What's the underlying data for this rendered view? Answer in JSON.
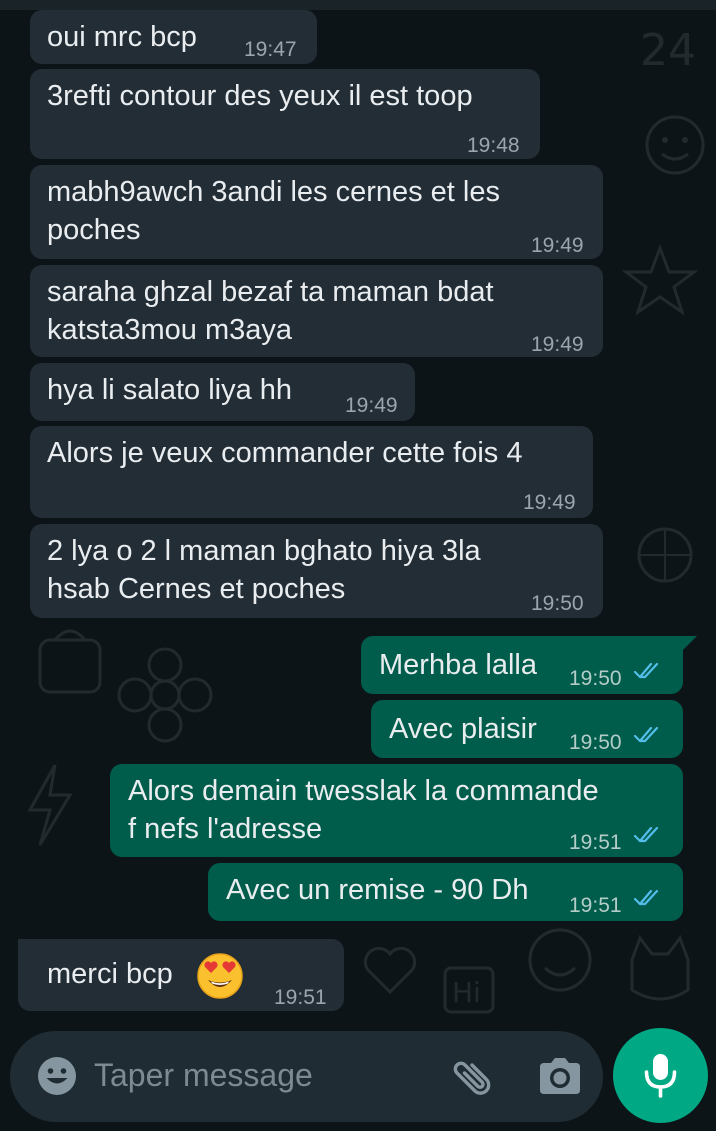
{
  "messages": [
    {
      "type": "incoming",
      "lines": [
        "oui mrc bcp"
      ],
      "time": "19:47"
    },
    {
      "type": "incoming",
      "lines": [
        "3refti contour des yeux il est toop"
      ],
      "time": "19:48"
    },
    {
      "type": "incoming",
      "lines": [
        "mabh9awch 3andi les cernes et les",
        "poches"
      ],
      "time": "19:49"
    },
    {
      "type": "incoming",
      "lines": [
        "saraha ghzal bezaf ta maman bdat",
        "katsta3mou m3aya"
      ],
      "time": "19:49"
    },
    {
      "type": "incoming",
      "lines": [
        "hya li salato liya hh"
      ],
      "time": "19:49"
    },
    {
      "type": "incoming",
      "lines": [
        "Alors je veux commander cette fois 4"
      ],
      "time": "19:49"
    },
    {
      "type": "incoming",
      "lines": [
        "2 lya o 2 l maman bghato hiya 3la",
        "hsab Cernes et poches"
      ],
      "time": "19:50"
    },
    {
      "type": "outgoing",
      "lines": [
        "Merhba lalla"
      ],
      "time": "19:50",
      "status": "read"
    },
    {
      "type": "outgoing",
      "lines": [
        "Avec plaisir"
      ],
      "time": "19:50",
      "status": "read"
    },
    {
      "type": "outgoing",
      "lines": [
        "Alors demain twesslak la commande",
        "f nefs l'adresse"
      ],
      "time": "19:51",
      "status": "read"
    },
    {
      "type": "outgoing",
      "lines": [
        "Avec un remise - 90 Dh"
      ],
      "time": "19:51",
      "status": "read"
    },
    {
      "type": "incoming",
      "lines": [
        "merci bcp"
      ],
      "emoji": "heart-eyes-emoji",
      "time": "19:51"
    }
  ],
  "composer": {
    "placeholder": "Taper message",
    "emoji_icon": "emoji-icon",
    "attach_icon": "paperclip-icon",
    "camera_icon": "camera-icon",
    "mic_icon": "microphone-icon"
  },
  "colors": {
    "background": "#0d1418",
    "incoming_bubble": "#232d36",
    "outgoing_bubble": "#005c4b",
    "read_ticks": "#53bdeb",
    "accent": "#00a884"
  }
}
